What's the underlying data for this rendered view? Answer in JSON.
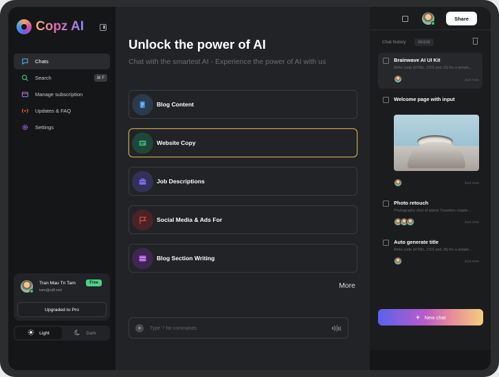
{
  "app": {
    "name": "Copz AI"
  },
  "sidebar": {
    "items": [
      {
        "label": "Chats",
        "icon": "chat-icon",
        "active": true
      },
      {
        "label": "Search",
        "icon": "search-icon",
        "shortcut": "⌘ F"
      },
      {
        "label": "Manage subscription",
        "icon": "card-icon"
      },
      {
        "label": "Updates & FAQ",
        "icon": "broadcast-icon"
      },
      {
        "label": "Settings",
        "icon": "gear-icon"
      }
    ],
    "user": {
      "name": "Tran Mau Tri Tam",
      "email": "tam@ui8.net",
      "plan": "Free"
    },
    "upgrade_label": "Upgraded to Pro",
    "theme": {
      "light": "Light",
      "dark": "Dark",
      "selected": "Light"
    }
  },
  "main": {
    "title": "Unlock the power of AI",
    "subtitle": "Chat with the smartest AI - Experience the power of AI with us",
    "options": [
      {
        "label": "Blog Content",
        "icon": "document-icon",
        "color": "#3f8fe0"
      },
      {
        "label": "Website Copy",
        "icon": "browser-icon",
        "color": "#35b37e",
        "highlighted": true
      },
      {
        "label": "Job Descriptions",
        "icon": "briefcase-icon",
        "color": "#7b6ee8"
      },
      {
        "label": "Social Media & Ads For",
        "icon": "flag-icon",
        "color": "#d84a4a"
      },
      {
        "label": "Blog Section Writing",
        "icon": "film-icon",
        "color": "#a24fd0"
      }
    ],
    "more_label": "More",
    "composer_placeholder": "Type '/' for commands"
  },
  "right": {
    "share_label": "Share",
    "history_label": "Chat history",
    "history_count": "26/100",
    "chats": [
      {
        "title": "Brainwave AI UI Kit",
        "desc": "Write code (HTML, CSS and JS) for a simple...",
        "time": "Just now",
        "active": true
      },
      {
        "title": "Welcome page with input",
        "desc": "",
        "time": "Just now"
      },
      {
        "title": "Photo retouch",
        "desc": "Photography shot of anime Travelers couple...",
        "time": "Just now"
      },
      {
        "title": "Auto generate title",
        "desc": "Write code (HTML, CSS and JS) for a simple...",
        "time": "Just now"
      }
    ],
    "new_chat_label": "New chat"
  }
}
